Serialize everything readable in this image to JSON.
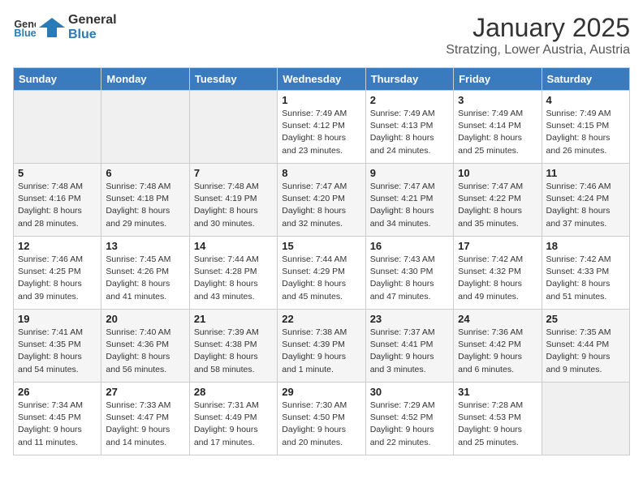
{
  "header": {
    "logo_general": "General",
    "logo_blue": "Blue",
    "month": "January 2025",
    "location": "Stratzing, Lower Austria, Austria"
  },
  "weekdays": [
    "Sunday",
    "Monday",
    "Tuesday",
    "Wednesday",
    "Thursday",
    "Friday",
    "Saturday"
  ],
  "weeks": [
    [
      {
        "day": "",
        "empty": true
      },
      {
        "day": "",
        "empty": true
      },
      {
        "day": "",
        "empty": true
      },
      {
        "day": "1",
        "sunrise": "7:49 AM",
        "sunset": "4:12 PM",
        "daylight": "8 hours and 23 minutes."
      },
      {
        "day": "2",
        "sunrise": "7:49 AM",
        "sunset": "4:13 PM",
        "daylight": "8 hours and 24 minutes."
      },
      {
        "day": "3",
        "sunrise": "7:49 AM",
        "sunset": "4:14 PM",
        "daylight": "8 hours and 25 minutes."
      },
      {
        "day": "4",
        "sunrise": "7:49 AM",
        "sunset": "4:15 PM",
        "daylight": "8 hours and 26 minutes."
      }
    ],
    [
      {
        "day": "5",
        "sunrise": "7:48 AM",
        "sunset": "4:16 PM",
        "daylight": "8 hours and 28 minutes."
      },
      {
        "day": "6",
        "sunrise": "7:48 AM",
        "sunset": "4:18 PM",
        "daylight": "8 hours and 29 minutes."
      },
      {
        "day": "7",
        "sunrise": "7:48 AM",
        "sunset": "4:19 PM",
        "daylight": "8 hours and 30 minutes."
      },
      {
        "day": "8",
        "sunrise": "7:47 AM",
        "sunset": "4:20 PM",
        "daylight": "8 hours and 32 minutes."
      },
      {
        "day": "9",
        "sunrise": "7:47 AM",
        "sunset": "4:21 PM",
        "daylight": "8 hours and 34 minutes."
      },
      {
        "day": "10",
        "sunrise": "7:47 AM",
        "sunset": "4:22 PM",
        "daylight": "8 hours and 35 minutes."
      },
      {
        "day": "11",
        "sunrise": "7:46 AM",
        "sunset": "4:24 PM",
        "daylight": "8 hours and 37 minutes."
      }
    ],
    [
      {
        "day": "12",
        "sunrise": "7:46 AM",
        "sunset": "4:25 PM",
        "daylight": "8 hours and 39 minutes."
      },
      {
        "day": "13",
        "sunrise": "7:45 AM",
        "sunset": "4:26 PM",
        "daylight": "8 hours and 41 minutes."
      },
      {
        "day": "14",
        "sunrise": "7:44 AM",
        "sunset": "4:28 PM",
        "daylight": "8 hours and 43 minutes."
      },
      {
        "day": "15",
        "sunrise": "7:44 AM",
        "sunset": "4:29 PM",
        "daylight": "8 hours and 45 minutes."
      },
      {
        "day": "16",
        "sunrise": "7:43 AM",
        "sunset": "4:30 PM",
        "daylight": "8 hours and 47 minutes."
      },
      {
        "day": "17",
        "sunrise": "7:42 AM",
        "sunset": "4:32 PM",
        "daylight": "8 hours and 49 minutes."
      },
      {
        "day": "18",
        "sunrise": "7:42 AM",
        "sunset": "4:33 PM",
        "daylight": "8 hours and 51 minutes."
      }
    ],
    [
      {
        "day": "19",
        "sunrise": "7:41 AM",
        "sunset": "4:35 PM",
        "daylight": "8 hours and 54 minutes."
      },
      {
        "day": "20",
        "sunrise": "7:40 AM",
        "sunset": "4:36 PM",
        "daylight": "8 hours and 56 minutes."
      },
      {
        "day": "21",
        "sunrise": "7:39 AM",
        "sunset": "4:38 PM",
        "daylight": "8 hours and 58 minutes."
      },
      {
        "day": "22",
        "sunrise": "7:38 AM",
        "sunset": "4:39 PM",
        "daylight": "9 hours and 1 minute."
      },
      {
        "day": "23",
        "sunrise": "7:37 AM",
        "sunset": "4:41 PM",
        "daylight": "9 hours and 3 minutes."
      },
      {
        "day": "24",
        "sunrise": "7:36 AM",
        "sunset": "4:42 PM",
        "daylight": "9 hours and 6 minutes."
      },
      {
        "day": "25",
        "sunrise": "7:35 AM",
        "sunset": "4:44 PM",
        "daylight": "9 hours and 9 minutes."
      }
    ],
    [
      {
        "day": "26",
        "sunrise": "7:34 AM",
        "sunset": "4:45 PM",
        "daylight": "9 hours and 11 minutes."
      },
      {
        "day": "27",
        "sunrise": "7:33 AM",
        "sunset": "4:47 PM",
        "daylight": "9 hours and 14 minutes."
      },
      {
        "day": "28",
        "sunrise": "7:31 AM",
        "sunset": "4:49 PM",
        "daylight": "9 hours and 17 minutes."
      },
      {
        "day": "29",
        "sunrise": "7:30 AM",
        "sunset": "4:50 PM",
        "daylight": "9 hours and 20 minutes."
      },
      {
        "day": "30",
        "sunrise": "7:29 AM",
        "sunset": "4:52 PM",
        "daylight": "9 hours and 22 minutes."
      },
      {
        "day": "31",
        "sunrise": "7:28 AM",
        "sunset": "4:53 PM",
        "daylight": "9 hours and 25 minutes."
      },
      {
        "day": "",
        "empty": true
      }
    ]
  ]
}
